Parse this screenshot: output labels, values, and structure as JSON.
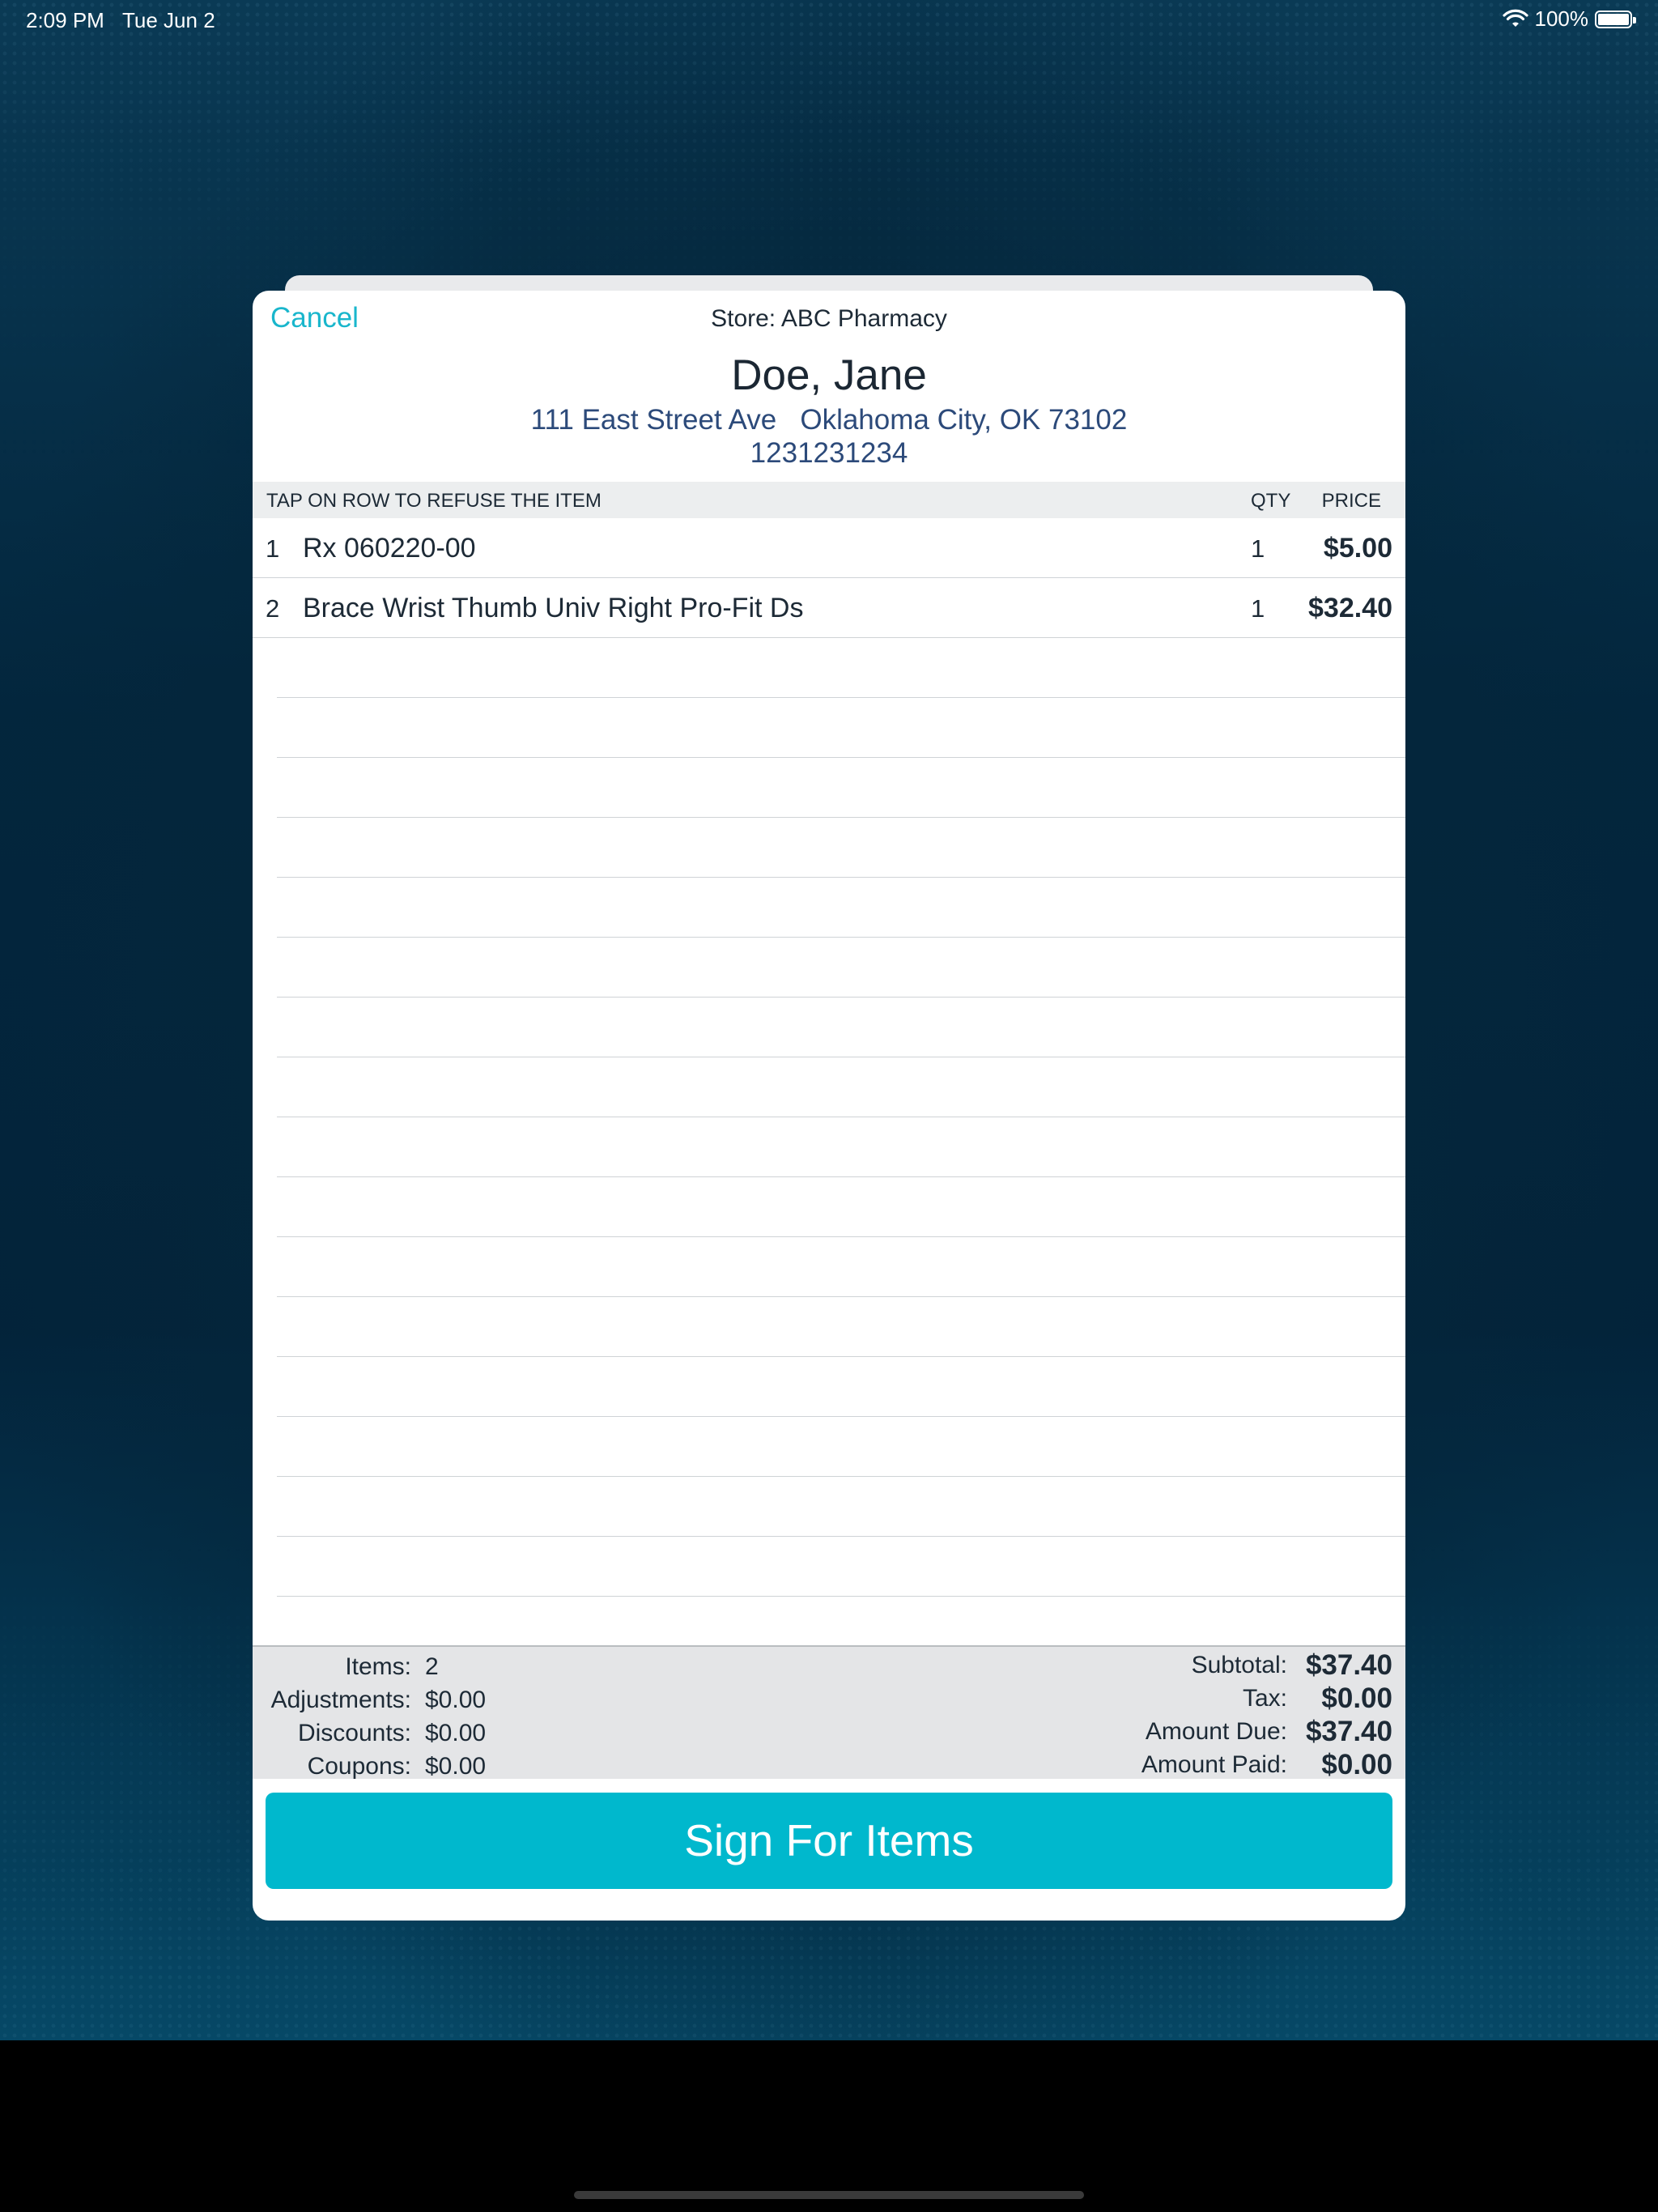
{
  "status_bar": {
    "time": "2:09 PM",
    "date": "Tue Jun 2",
    "battery": "100%",
    "icons": [
      "wifi-icon",
      "battery-icon"
    ]
  },
  "header": {
    "cancel_label": "Cancel",
    "store": "Store: ABC Pharmacy",
    "customer_name": "Doe, Jane",
    "address": "111 East Street Ave   Oklahoma City, OK 73102",
    "phone": "1231231234"
  },
  "table": {
    "instruction": "TAP ON ROW TO REFUSE THE ITEM",
    "qty_header": "QTY",
    "price_header": "PRICE",
    "items": [
      {
        "num": "1",
        "description": "Rx 060220-00",
        "qty": "1",
        "price": "$5.00"
      },
      {
        "num": "2",
        "description": "Brace Wrist Thumb Univ Right Pro-Fit Ds",
        "qty": "1",
        "price": "$32.40"
      }
    ]
  },
  "summary": {
    "left": [
      {
        "label": "Items:",
        "value": "2"
      },
      {
        "label": "Adjustments:",
        "value": "$0.00"
      },
      {
        "label": "Discounts:",
        "value": "$0.00"
      },
      {
        "label": "Coupons:",
        "value": "$0.00"
      }
    ],
    "right": [
      {
        "label": "Subtotal:",
        "value": "$37.40"
      },
      {
        "label": "Tax:",
        "value": "$0.00"
      },
      {
        "label": "Amount Due:",
        "value": "$37.40"
      },
      {
        "label": "Amount Paid:",
        "value": "$0.00"
      }
    ]
  },
  "actions": {
    "sign_label": "Sign For Items"
  },
  "colors": {
    "accent": "#00b8cd",
    "link": "#19b6cc",
    "address_text": "#2c4a7a"
  }
}
